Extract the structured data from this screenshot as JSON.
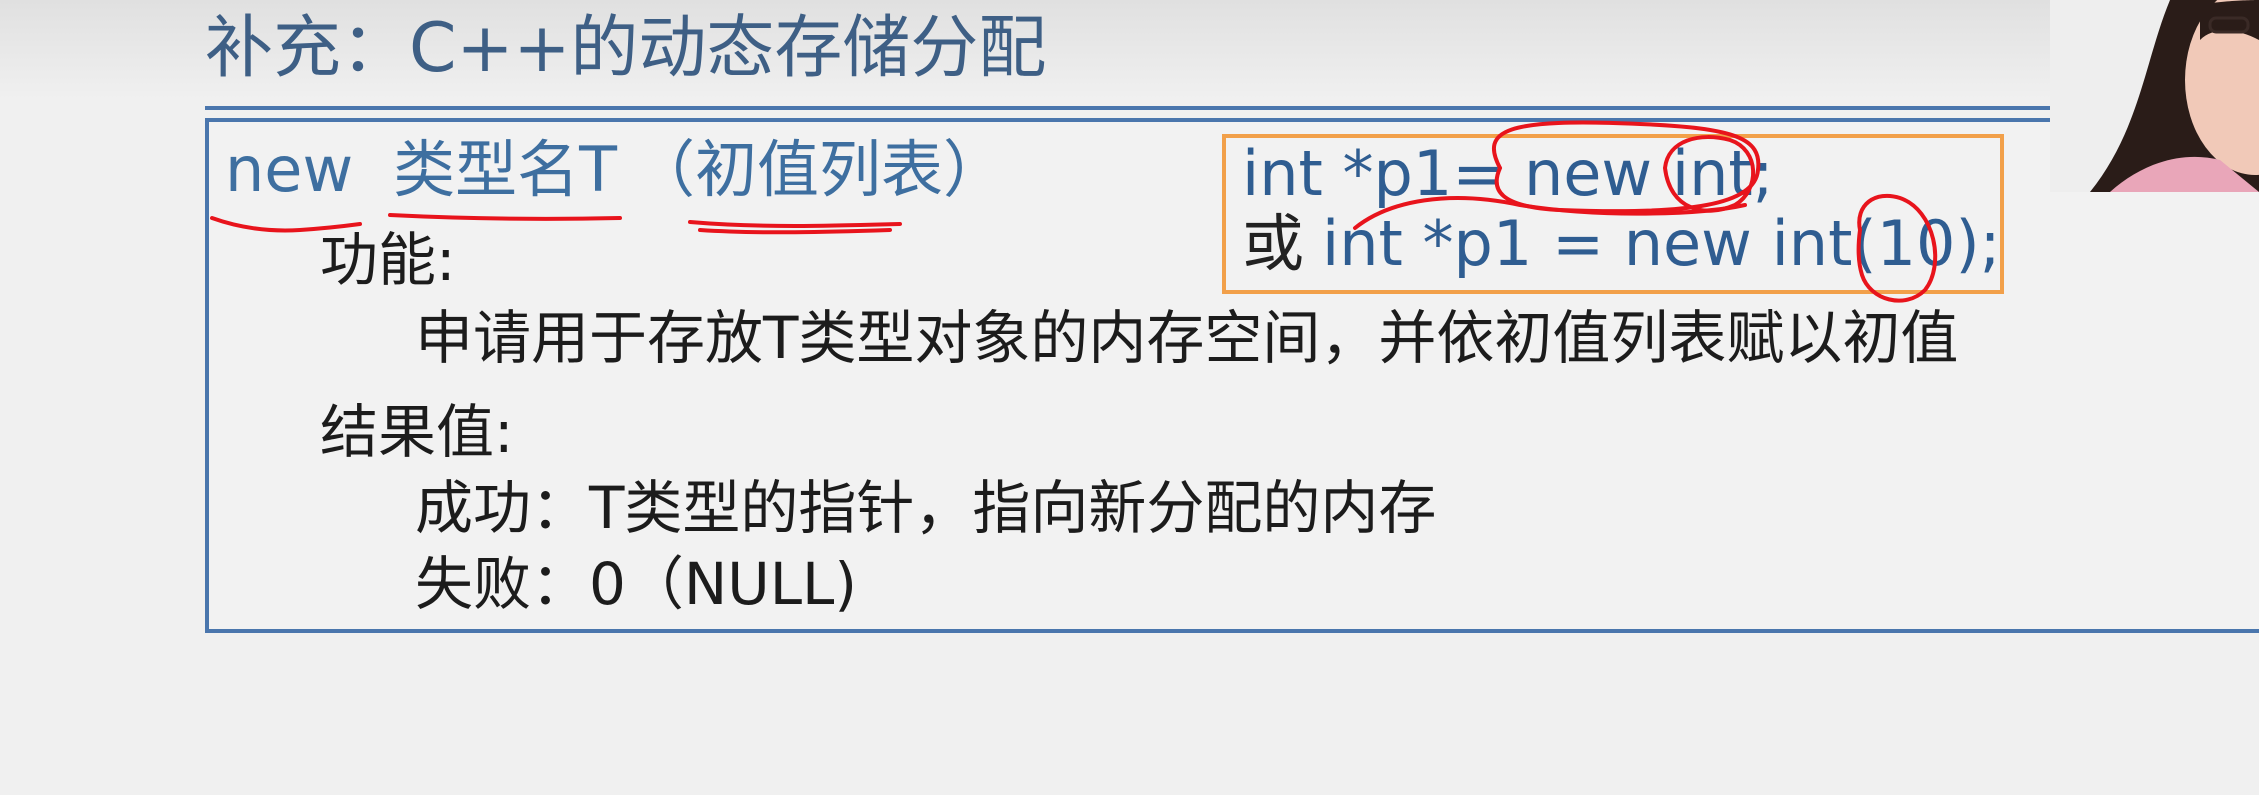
{
  "slide": {
    "title": "补充：C++的动态存储分配",
    "syntax": {
      "keyword": "new",
      "type_name": "类型名T",
      "init_list": "（初值列表）"
    },
    "code": {
      "line1": "int *p1= new int;",
      "line2_prefix": "或",
      "line2_code": "int *p1 = new int(10);"
    },
    "function_label": "功能:",
    "function_desc": "申请用于存放T类型对象的内存空间，并依初值列表赋以初值",
    "result_label": "结果值:",
    "success_text": "成功：T类型的指针，指向新分配的内存",
    "failure_text": "失败：0（NULL)"
  },
  "colors": {
    "title": "#3e5f85",
    "frame": "#4a76ad",
    "code_border": "#f2a04a",
    "annotation": "#e8141c"
  }
}
